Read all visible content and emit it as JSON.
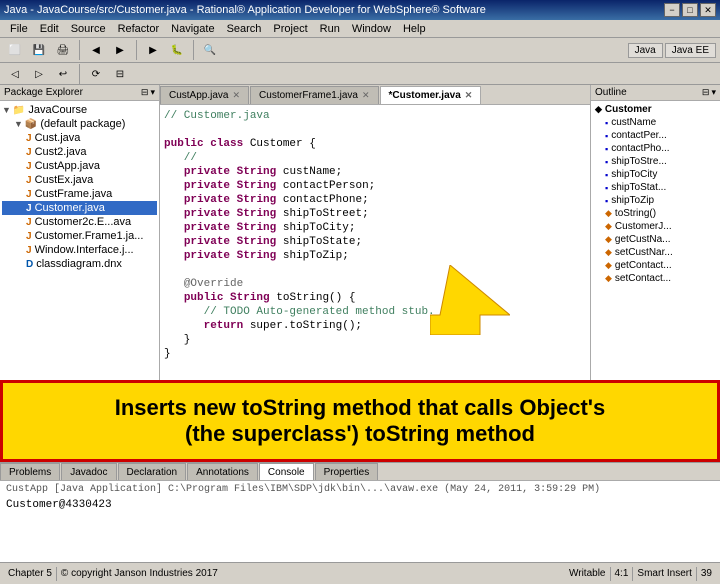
{
  "window": {
    "title": "Java - JavaCourse/src/Customer.java - Rational® Application Developer for WebSphere® Software",
    "minimize": "−",
    "maximize": "□",
    "close": "✕"
  },
  "menubar": {
    "items": [
      "File",
      "Edit",
      "Source",
      "Refactor",
      "Navigate",
      "Search",
      "Project",
      "Run",
      "Window",
      "Help"
    ]
  },
  "tabs": {
    "items": [
      {
        "label": "CustApp.java",
        "active": false
      },
      {
        "label": "CustomerFrame1.java",
        "active": false
      },
      {
        "label": "*Customer.java",
        "active": true
      }
    ]
  },
  "code": {
    "title": "// Customer.java",
    "lines": [
      {
        "num": "",
        "text": "// Customer.java"
      },
      {
        "num": "",
        "text": ""
      },
      {
        "num": "",
        "text": "public class Customer {"
      },
      {
        "num": "",
        "text": "   //"
      },
      {
        "num": "",
        "text": "   private String custName;"
      },
      {
        "num": "",
        "text": "   private String contactPerson;"
      },
      {
        "num": "",
        "text": "   private String contactPhone;"
      },
      {
        "num": "",
        "text": "   private String shipToStreet;"
      },
      {
        "num": "",
        "text": "   private String shipToCity;"
      },
      {
        "num": "",
        "text": "   private String shipToState;"
      },
      {
        "num": "",
        "text": "   private String shipToZip;"
      },
      {
        "num": "",
        "text": ""
      },
      {
        "num": "",
        "text": "   @Override"
      },
      {
        "num": "",
        "text": "   public String toString() {"
      },
      {
        "num": "",
        "text": "      // TODO Auto-generated method stub."
      },
      {
        "num": "",
        "text": "      return super.toString();"
      },
      {
        "num": "",
        "text": "   }"
      },
      {
        "num": "",
        "text": "}"
      }
    ]
  },
  "package_explorer": {
    "title": "Package Explorer",
    "items": [
      {
        "label": "JavaCourse",
        "indent": 0,
        "icon": "📁",
        "toggle": "▼"
      },
      {
        "label": "(default package)",
        "indent": 1,
        "icon": "📦",
        "toggle": "▼"
      },
      {
        "label": "Cust.java",
        "indent": 2,
        "icon": "J"
      },
      {
        "label": "Cust2.java",
        "indent": 2,
        "icon": "J"
      },
      {
        "label": "CustApp.java",
        "indent": 2,
        "icon": "J"
      },
      {
        "label": "CustEx.java",
        "indent": 2,
        "icon": "J"
      },
      {
        "label": "CustFrame.java",
        "indent": 2,
        "icon": "J"
      },
      {
        "label": "Customer.java",
        "indent": 2,
        "icon": "J"
      },
      {
        "label": "Customer2c.E...ava",
        "indent": 2,
        "icon": "J"
      },
      {
        "label": "Customer.Frame1.ja...",
        "indent": 2,
        "icon": "J"
      },
      {
        "label": "Window.Interface.j...",
        "indent": 2,
        "icon": "J"
      },
      {
        "label": "classdiagram.dnx",
        "indent": 2,
        "icon": "D"
      }
    ]
  },
  "outline": {
    "title": "Outline",
    "root": "Customer",
    "items": [
      {
        "label": "custName",
        "indent": 1,
        "icon": "▪"
      },
      {
        "label": "contactPer...",
        "indent": 1,
        "icon": "▪"
      },
      {
        "label": "contactPho...",
        "indent": 1,
        "icon": "▪"
      },
      {
        "label": "shipToStre...",
        "indent": 1,
        "icon": "▪"
      },
      {
        "label": "shipToCity",
        "indent": 1,
        "icon": "▪"
      },
      {
        "label": "shipToStat...",
        "indent": 1,
        "icon": "▪"
      },
      {
        "label": "shipToZip",
        "indent": 1,
        "icon": "▪"
      },
      {
        "label": "toString()",
        "indent": 1,
        "icon": "◆"
      },
      {
        "label": "CustomerJ...",
        "indent": 1,
        "icon": "◆"
      },
      {
        "label": "getCustNa...",
        "indent": 1,
        "icon": "◆"
      },
      {
        "label": "setCustNar...",
        "indent": 1,
        "icon": "◆"
      },
      {
        "label": "getContact...",
        "indent": 1,
        "icon": "◆"
      },
      {
        "label": "setContact...",
        "indent": 1,
        "icon": "◆"
      }
    ]
  },
  "annotation": {
    "line1": "Inserts new toString method that calls Object's",
    "line2": "(the superclass') toString method"
  },
  "bottom_tabs": [
    "Problems",
    "Javadoc",
    "Declaration",
    "Annotations",
    "Console",
    "Properties"
  ],
  "active_bottom_tab": "Console",
  "console": {
    "label": "CustApp [Java Application] C:\\Program Files\\IBM\\SDP\\jdk\\bin\\...\\avaw.exe (May 24, 2011, 3:59:29 PM)",
    "output": "Customer@4330423"
  },
  "statusbar": {
    "left": "Chapter 5",
    "center": "© copyright Janson Industries 2017",
    "right": "39",
    "writeable": "Writable",
    "cursor": "4:1",
    "insert": "Smart Insert"
  },
  "perspectives": {
    "java": "Java",
    "javaee": "Java EE"
  }
}
